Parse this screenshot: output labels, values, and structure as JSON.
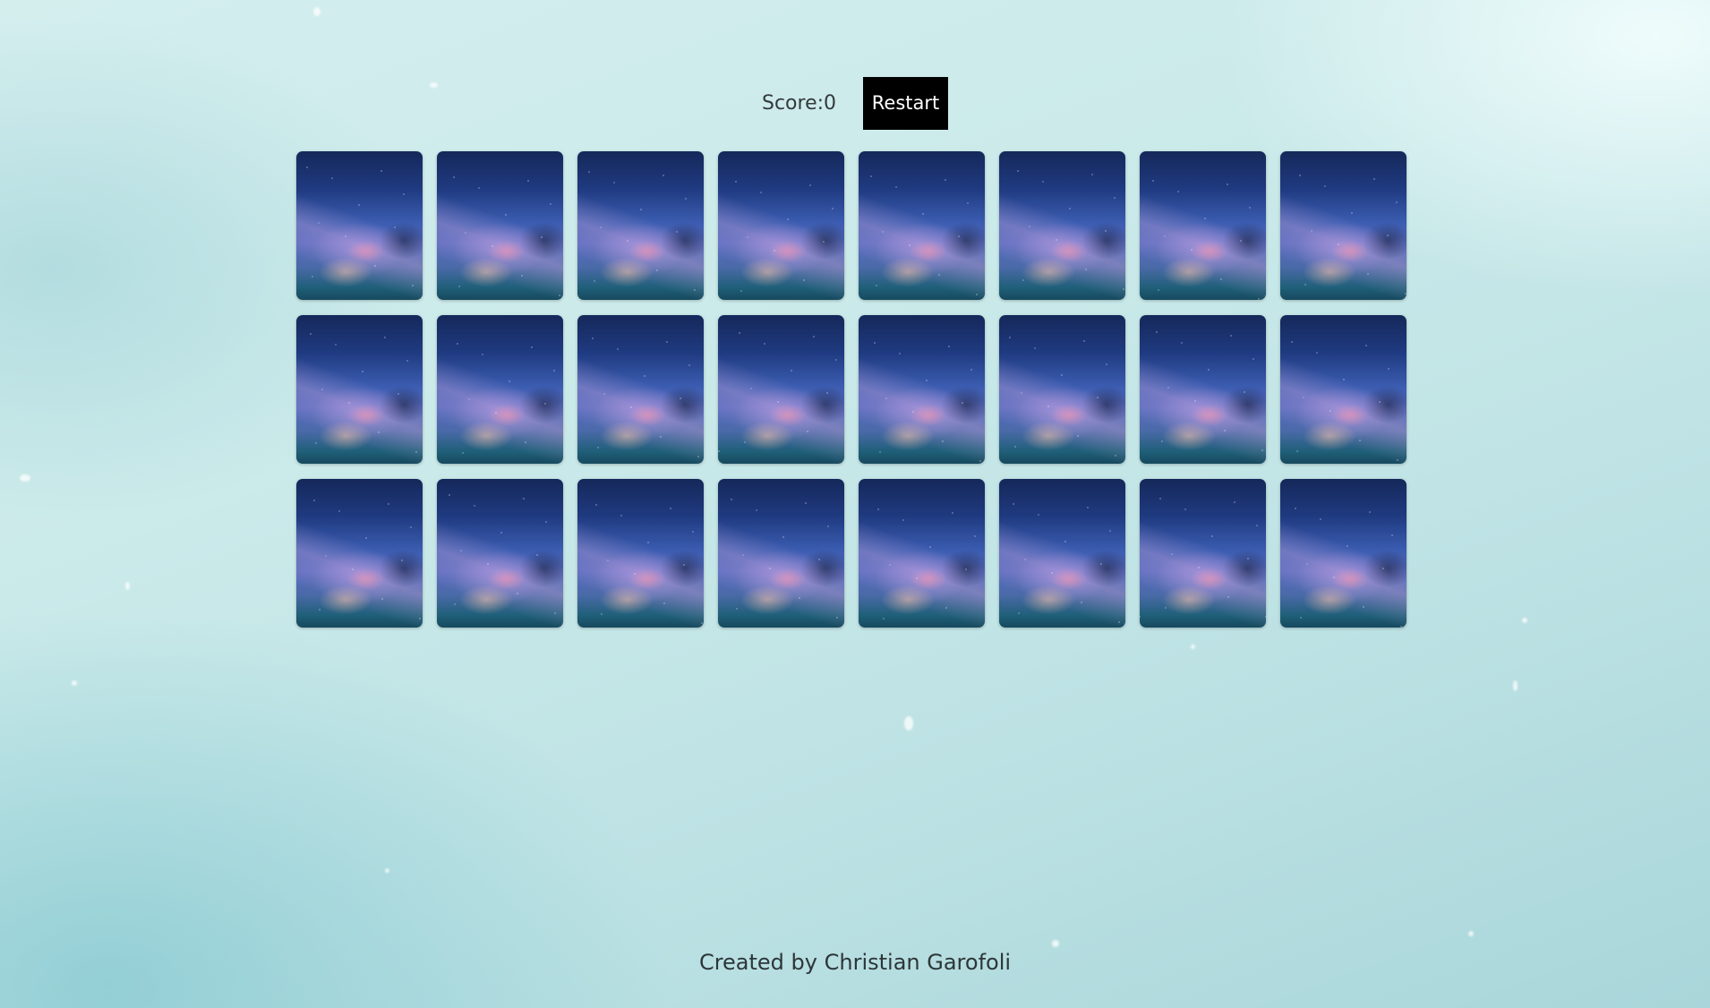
{
  "header": {
    "score_label": "Score:",
    "score_value": "0",
    "restart_label": "Restart"
  },
  "board": {
    "rows": 3,
    "columns": 8,
    "cards": [
      {
        "state": "face-down",
        "back": "galaxy-card-back"
      },
      {
        "state": "face-down",
        "back": "galaxy-card-back"
      },
      {
        "state": "face-down",
        "back": "galaxy-card-back"
      },
      {
        "state": "face-down",
        "back": "galaxy-card-back"
      },
      {
        "state": "face-down",
        "back": "galaxy-card-back"
      },
      {
        "state": "face-down",
        "back": "galaxy-card-back"
      },
      {
        "state": "face-down",
        "back": "galaxy-card-back"
      },
      {
        "state": "face-down",
        "back": "galaxy-card-back"
      },
      {
        "state": "face-down",
        "back": "galaxy-card-back"
      },
      {
        "state": "face-down",
        "back": "galaxy-card-back"
      },
      {
        "state": "face-down",
        "back": "galaxy-card-back"
      },
      {
        "state": "face-down",
        "back": "galaxy-card-back"
      },
      {
        "state": "face-down",
        "back": "galaxy-card-back"
      },
      {
        "state": "face-down",
        "back": "galaxy-card-back"
      },
      {
        "state": "face-down",
        "back": "galaxy-card-back"
      },
      {
        "state": "face-down",
        "back": "galaxy-card-back"
      },
      {
        "state": "face-down",
        "back": "galaxy-card-back"
      },
      {
        "state": "face-down",
        "back": "galaxy-card-back"
      },
      {
        "state": "face-down",
        "back": "galaxy-card-back"
      },
      {
        "state": "face-down",
        "back": "galaxy-card-back"
      },
      {
        "state": "face-down",
        "back": "galaxy-card-back"
      },
      {
        "state": "face-down",
        "back": "galaxy-card-back"
      },
      {
        "state": "face-down",
        "back": "galaxy-card-back"
      },
      {
        "state": "face-down",
        "back": "galaxy-card-back"
      }
    ]
  },
  "footer": {
    "credit": "Created by Christian Garofoli"
  },
  "colors": {
    "background": "#c6e7e8",
    "restart_button_bg": "#000000",
    "restart_button_text": "#ffffff"
  }
}
